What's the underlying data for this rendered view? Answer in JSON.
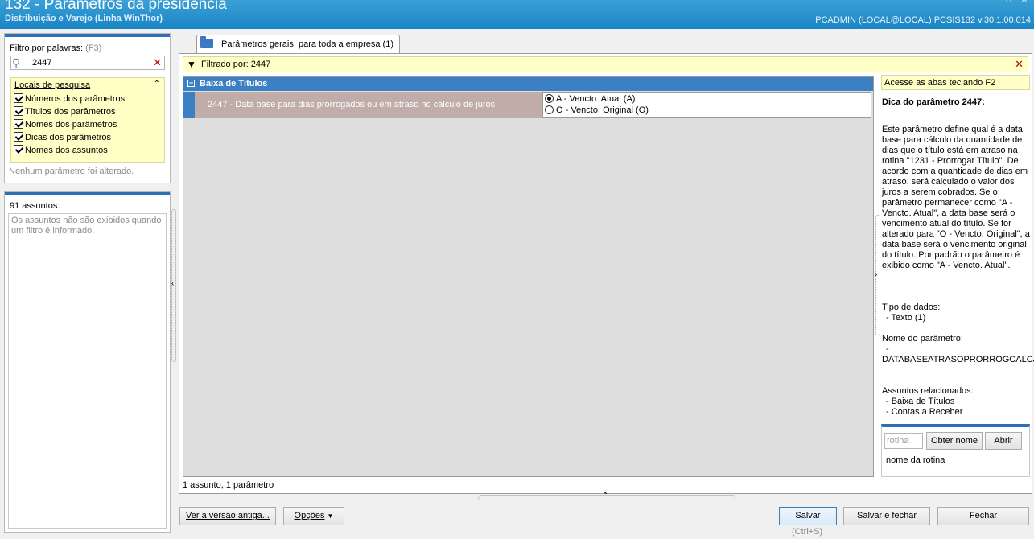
{
  "window": {
    "title": "132 - Parâmetros da presidência",
    "subtitle": "Distribuição e Varejo (Linha WinThor)",
    "user_info": "PCADMIN (LOCAL@LOCAL)   PCSIS132  v.30.1.00.014"
  },
  "filter": {
    "label": "Filtro por palavras:",
    "shortcut": "(F3)",
    "value": "2447",
    "locais_title": "Locais de pesquisa",
    "options": [
      {
        "label": "Números dos parâmetros",
        "checked": true
      },
      {
        "label": "Títulos dos parâmetros",
        "checked": true
      },
      {
        "label": "Nomes dos parâmetros",
        "checked": true
      },
      {
        "label": "Dicas dos parâmetros",
        "checked": true
      },
      {
        "label": "Nomes dos assuntos",
        "checked": true
      }
    ],
    "status": "Nenhum parâmetro foi alterado."
  },
  "subjects": {
    "count_label": "91 assuntos:",
    "empty_text": "Os assuntos não são exibidos quando um filtro é informado."
  },
  "tab": {
    "label": "Parâmetros gerais, para toda a empresa  (1)"
  },
  "filterbar": {
    "text": "Filtrado por: 2447"
  },
  "grid": {
    "group_title": "Baixa de Títulos",
    "param_desc": "2447 - Data base para dias prorrogados ou em atraso no cálculo de juros.",
    "options": [
      {
        "label": "A - Vencto. Atual (A)",
        "selected": true
      },
      {
        "label": "O - Vencto. Original (O)",
        "selected": false
      }
    ],
    "status": "1 assunto, 1 parâmetro"
  },
  "help": {
    "tip": "Acesse as abas teclando F2",
    "title": "Dica do parâmetro 2447:",
    "body": "Este parâmetro define qual é a data base para cálculo da quantidade de dias que o título está em atraso na rotina \"1231 - Prorrogar Título\". De acordo com a quantidade de dias em atraso, será calculado o valor dos juros a serem cobrados. Se o parâmetro permanecer como \"A - Vencto. Atual\", a data base será o vencimento atual do título. Se for alterado para \"O - Vencto. Original\", a data base será o vencimento original do título. Por padrão o parâmetro é exibido como \"A - Vencto. Atual\".",
    "data_type_label": "Tipo de dados:",
    "data_type_value": "- Texto (1)",
    "param_name_label": "Nome do parâmetro:",
    "param_name_dash": "-",
    "param_name_value": "DATABASEATRASOPRORROGCALCJU",
    "related_label": "Assuntos relacionados:",
    "related": [
      "- Baixa de Títulos",
      "- Contas a Receber"
    ]
  },
  "rotina": {
    "placeholder": "rotina",
    "get_name_label": "Obter nome",
    "open_label": "Abrir",
    "name_label": "nome da rotina"
  },
  "buttons": {
    "old_version": "Ver a versão antiga...",
    "options": "Opções",
    "save": "Salvar",
    "save_hint": "(Ctrl+S)",
    "save_close": "Salvar e fechar",
    "close": "Fechar"
  }
}
